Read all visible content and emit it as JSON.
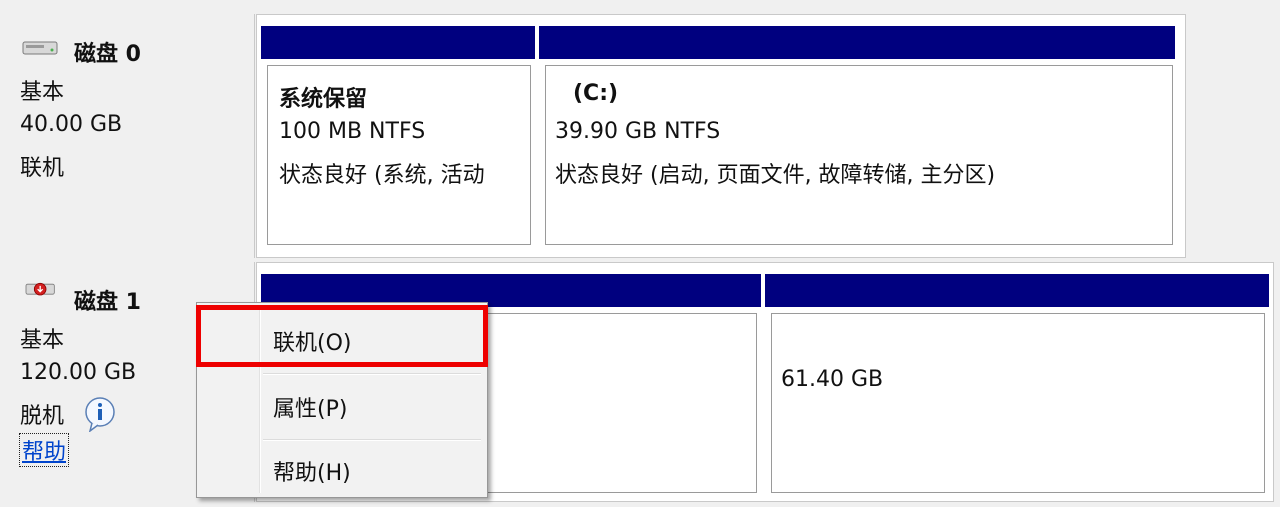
{
  "disk0": {
    "title": "磁盘 0",
    "type": "基本",
    "size": "40.00 GB",
    "status": "联机",
    "partitions": [
      {
        "title": "系统保留",
        "size_fs": "100 MB NTFS",
        "status": "状态良好 (系统, 活动"
      },
      {
        "title": "(C:)",
        "size_fs": "39.90 GB NTFS",
        "status": "状态良好 (启动, 页面文件, 故障转储, 主分区)"
      }
    ]
  },
  "disk1": {
    "title": "磁盘 1",
    "type": "基本",
    "size": "120.00 GB",
    "status": "脱机",
    "help_link": "帮助",
    "partitions": [
      {
        "size": ""
      },
      {
        "size": "61.40 GB"
      }
    ]
  },
  "context_menu": {
    "items": [
      "联机(O)",
      "属性(P)",
      "帮助(H)"
    ],
    "highlighted_index": 0
  },
  "colors": {
    "partition_bar": "#00007f",
    "highlight_border": "#ee0000",
    "link": "#0044cc"
  },
  "icons": [
    "disk-icon",
    "offline-disk-icon",
    "info-icon"
  ]
}
